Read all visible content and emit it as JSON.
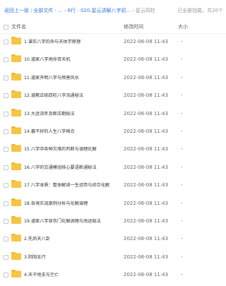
{
  "breadcrumb": {
    "back": "返回上一级",
    "sep": "|",
    "all_files": "全部文件",
    "ellipsis": "...",
    "level1": "6行",
    "level2": "020.星云讲解八字初...",
    "current": "星云四柱"
  },
  "status": {
    "loaded_text": "已全部加载，共20个"
  },
  "columns": {
    "name": "文件名",
    "time": "修改时间",
    "size": "大小"
  },
  "files": [
    {
      "name": "1.课实八字的命与天体学原理",
      "time": "2022-06-08 11:43",
      "size": "-"
    },
    {
      "name": "10.道家八字地命否天机",
      "time": "2022-06-08 11:43",
      "size": "-"
    },
    {
      "name": "11.道家开明八字与频害风水",
      "time": "2022-06-08 11:43",
      "size": "-"
    },
    {
      "name": "12.道教正统四柱八字流通秘法",
      "time": "2022-06-08 11:43",
      "size": "-"
    },
    {
      "name": "13.大运流年及断应期秘法",
      "time": "2022-06-08 11:43",
      "size": "-"
    },
    {
      "name": "14.暮不好的人生八字格合",
      "time": "2022-06-08 11:43",
      "size": "-"
    },
    {
      "name": "15.八字中各种灾难的判断与调理化解",
      "time": "2022-06-08 11:43",
      "size": "-"
    },
    {
      "name": "16.八字的交通模组核心要语断通秘法",
      "time": "2022-06-08 11:43",
      "size": "-"
    },
    {
      "name": "17.八字本质：整体解读一生运势与综合化解",
      "time": "2022-06-08 11:43",
      "size": "-"
    },
    {
      "name": "18.各境实战案例分析与化解调理",
      "time": "2022-06-08 11:43",
      "size": "-"
    },
    {
      "name": "19.道家八字穿衣门化解调理与改运秘法",
      "time": "2022-06-08 11:43",
      "size": "-"
    },
    {
      "name": "2.先后天八卦",
      "time": "2022-06-08 11:43",
      "size": "-"
    },
    {
      "name": "3.阴阳五行",
      "time": "2022-06-08 11:43",
      "size": "-"
    },
    {
      "name": "4.天干地支与空亡",
      "time": "2022-06-08 11:43",
      "size": "-"
    }
  ],
  "colors": {
    "link": "#2f7de1",
    "folder": "#f7c544",
    "folder_tab": "#f1b72f"
  },
  "icons": {
    "folder": "folder-icon",
    "checkbox": "checkbox"
  }
}
